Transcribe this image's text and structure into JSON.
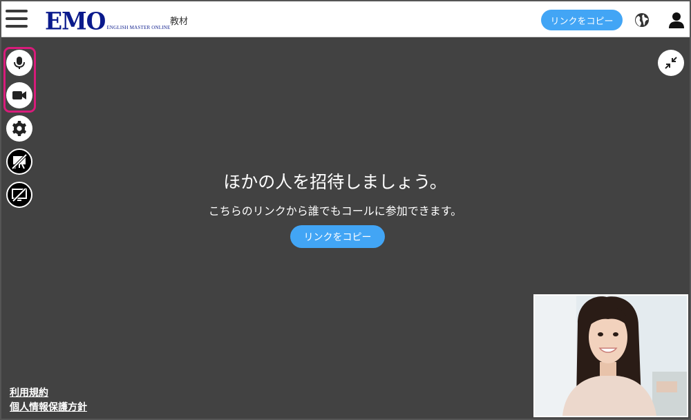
{
  "header": {
    "logo_main": "EMO",
    "logo_sub": "ENGLISH MASTER ONLINE",
    "nav_material": "教材",
    "copy_link_label": "リンクをコピー"
  },
  "invite": {
    "title": "ほかの人を招待しましょう。",
    "subtitle": "こちらのリンクから誰でもコールに参加できます。",
    "copy_link_label": "リンクをコピー"
  },
  "footer": {
    "terms": "利用規約",
    "privacy": "個人情報保護方針"
  },
  "controls": [
    {
      "icon": "microphone-icon",
      "state": "on"
    },
    {
      "icon": "video-camera-icon",
      "state": "on"
    },
    {
      "icon": "gear-icon",
      "state": "on"
    },
    {
      "icon": "whiteboard-off-icon",
      "state": "off"
    },
    {
      "icon": "screen-share-off-icon",
      "state": "off"
    }
  ],
  "colors": {
    "accent": "#42a5f5",
    "highlight": "#d81b7a",
    "stage_bg": "#424242",
    "logo": "#0a1a8c"
  }
}
